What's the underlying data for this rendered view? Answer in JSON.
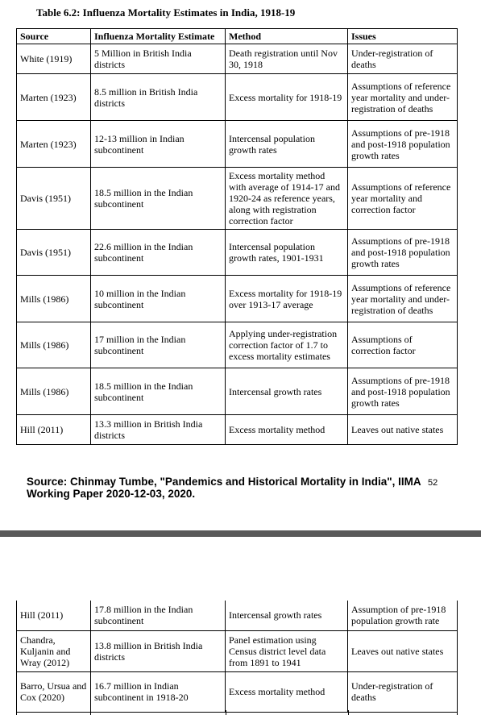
{
  "page1": {
    "title": "Table 6.2: Influenza Mortality Estimates in India, 1918-19",
    "headers": [
      "Source",
      "Influenza Mortality Estimate",
      "Method",
      "Issues"
    ],
    "rows": [
      {
        "source": "White (1919)",
        "estimate": "5 Million in British India districts",
        "method": "Death registration until Nov 30, 1918",
        "issues": "Under-registration of deaths"
      },
      {
        "source": "Marten (1923)",
        "estimate": "8.5 million in British India districts",
        "method": "Excess mortality for 1918-19",
        "issues": "Assumptions of reference year mortality and under-registration of deaths"
      },
      {
        "source": "Marten (1923)",
        "estimate": "12-13 million in Indian subcontinent",
        "method": "Intercensal population growth rates",
        "issues": "Assumptions of pre-1918 and post-1918 population growth rates"
      },
      {
        "source": "Davis (1951)",
        "estimate": "18.5 million in the Indian subcontinent",
        "method": "Excess mortality method with average of 1914-17 and 1920-24 as reference years, along with registration correction factor",
        "issues": "Assumptions of reference year mortality and correction factor"
      },
      {
        "source": "Davis (1951)",
        "estimate": "22.6 million in the Indian subcontinent",
        "method": "Intercensal population growth rates, 1901-1931",
        "issues": "Assumptions of pre-1918 and post-1918 population growth rates"
      },
      {
        "source": "Mills (1986)",
        "estimate": "10 million in the Indian subcontinent",
        "method": "Excess mortality for 1918-19 over 1913-17 average",
        "issues": "Assumptions of reference year mortality and under-registration of deaths"
      },
      {
        "source": "Mills (1986)",
        "estimate": "17 million in the Indian subcontinent",
        "method": "Applying under-registration correction factor of 1.7 to excess mortality estimates",
        "issues": "Assumptions of correction factor"
      },
      {
        "source": "Mills (1986)",
        "estimate": "18.5 million in the Indian subcontinent",
        "method": "Intercensal growth rates",
        "issues": "Assumptions of pre-1918 and post-1918 population growth rates"
      },
      {
        "source": "Hill (2011)",
        "estimate": "13.3 million in British India districts",
        "method": "Excess mortality method",
        "issues": "Leaves out native states"
      }
    ],
    "source_note": "Source: Chinmay Tumbe, \"Pandemics and Historical Mortality in India\", IIMA Working Paper 2020-12-03, 2020.",
    "page_number": "52"
  },
  "page2": {
    "rows": [
      {
        "source": "Hill (2011)",
        "estimate": "17.8 million in the Indian subcontinent",
        "method": "Intercensal growth rates",
        "issues": "Assumption of pre-1918 population growth rate"
      },
      {
        "source": "Chandra, Kuljanin and Wray (2012)",
        "estimate": "13.8 million in British India districts",
        "method": "Panel estimation using Census district level data from 1891 to 1941",
        "issues": "Leaves out native states"
      },
      {
        "source": "Barro, Ursua and Cox (2020)",
        "estimate": "16.7 million in Indian subcontinent in 1918-20",
        "method": "Excess mortality method",
        "issues": "Under-registration of deaths"
      }
    ]
  }
}
